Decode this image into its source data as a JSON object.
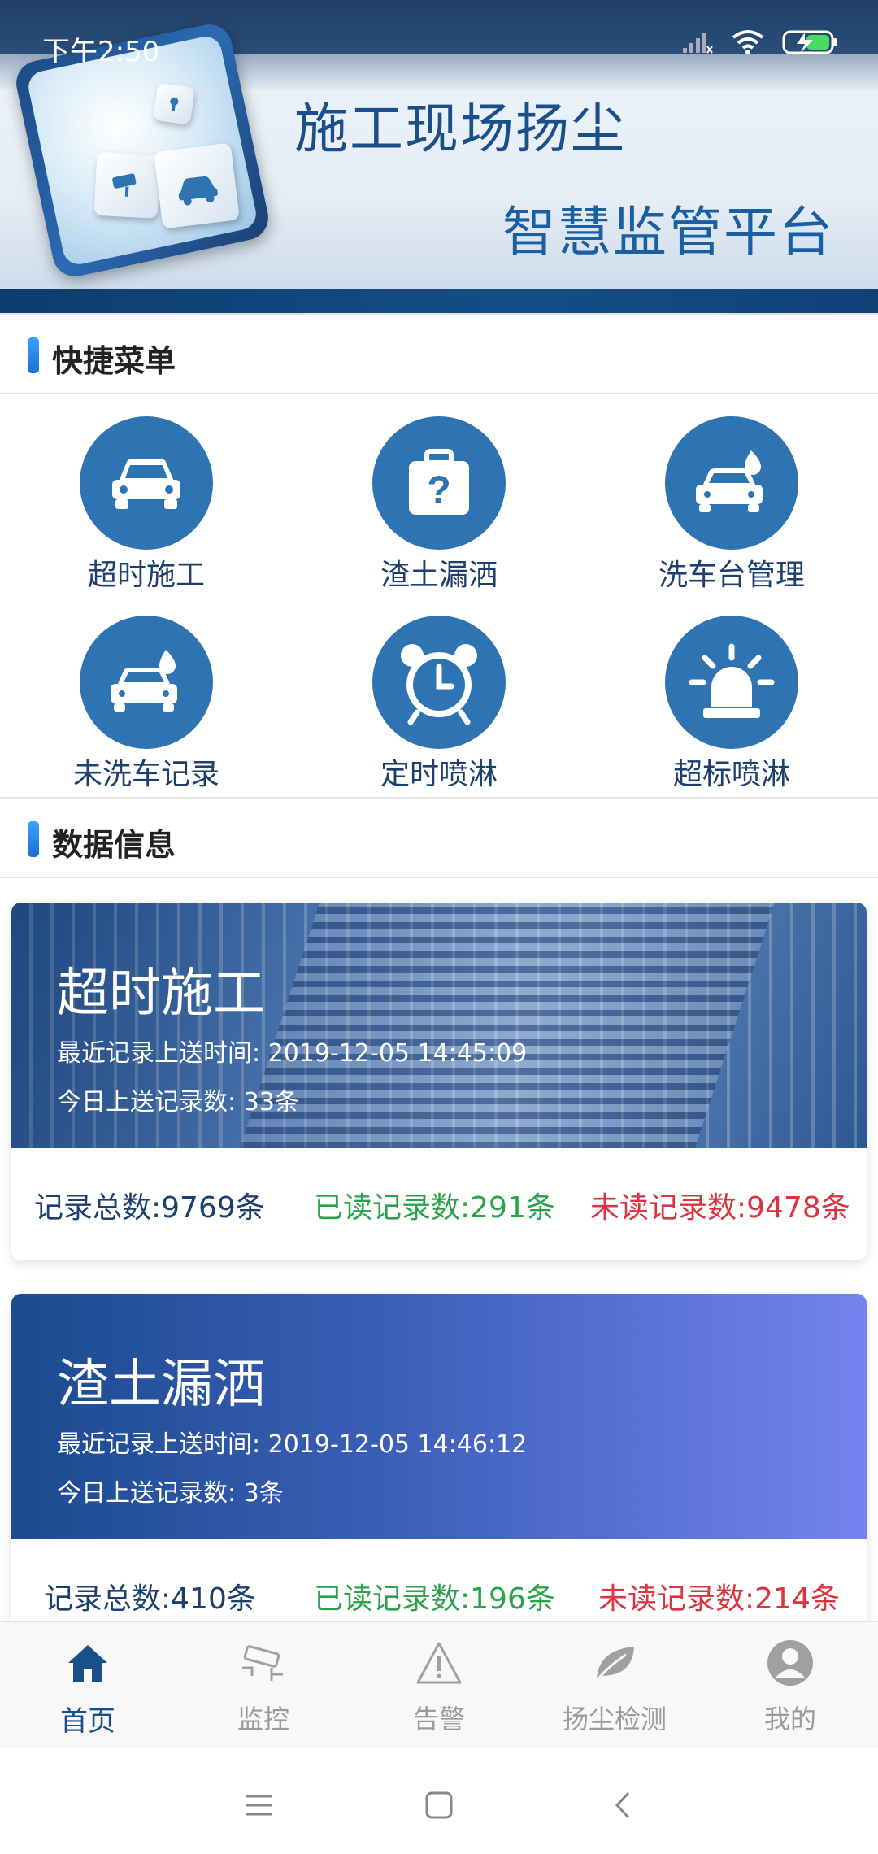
{
  "status_bar": {
    "time": "下午2:50"
  },
  "banner": {
    "title_line1": "施工现场扬尘",
    "title_line2": "智慧监管平台"
  },
  "quick_menu": {
    "heading": "快捷菜单",
    "items": [
      {
        "label": "超时施工",
        "icon": "car-icon"
      },
      {
        "label": "渣土漏洒",
        "icon": "question-box-icon"
      },
      {
        "label": "洗车台管理",
        "icon": "car-wash-icon"
      },
      {
        "label": "未洗车记录",
        "icon": "car-wash-icon"
      },
      {
        "label": "定时喷淋",
        "icon": "alarm-clock-icon"
      },
      {
        "label": "超标喷淋",
        "icon": "siren-icon"
      }
    ]
  },
  "data_info": {
    "heading": "数据信息",
    "cards": [
      {
        "title": "超时施工",
        "last_upload": "最近记录上送时间: 2019-12-05 14:45:09",
        "today_count": "今日上送记录数: 33条",
        "total": "记录总数:9769条",
        "read": "已读记录数:291条",
        "unread": "未读记录数:9478条"
      },
      {
        "title": "渣土漏洒",
        "last_upload": "最近记录上送时间: 2019-12-05 14:46:12",
        "today_count": "今日上送记录数: 3条",
        "total": "记录总数:410条",
        "read": "已读记录数:196条",
        "unread": "未读记录数:214条"
      }
    ]
  },
  "tabs": [
    {
      "label": "首页",
      "icon": "home-icon",
      "active": true
    },
    {
      "label": "监控",
      "icon": "cctv-camera-icon",
      "active": false
    },
    {
      "label": "告警",
      "icon": "warning-icon",
      "active": false
    },
    {
      "label": "扬尘检测",
      "icon": "leaf-icon",
      "active": false
    },
    {
      "label": "我的",
      "icon": "user-icon",
      "active": false
    }
  ],
  "colors": {
    "brand_blue": "#2f74b2",
    "title_blue": "#1b4f8c",
    "read_green": "#2aa24b",
    "unread_red": "#d9343f"
  }
}
